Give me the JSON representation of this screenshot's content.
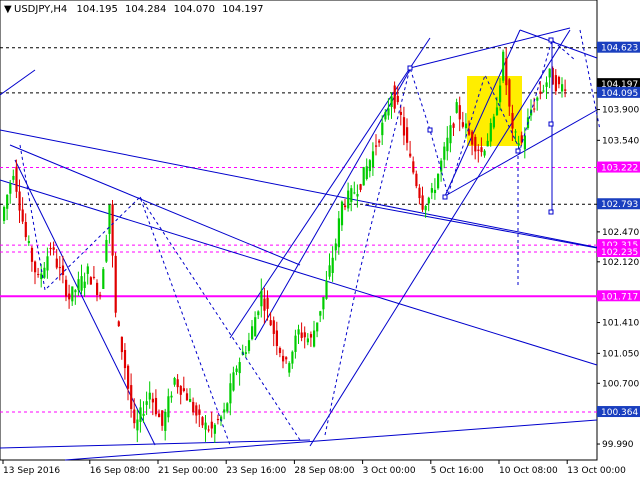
{
  "chart_data": {
    "type": "candlestick",
    "header": {
      "arrow_icon": "triangle-down-icon",
      "symbol": "USDJPY,H4",
      "open": "104.195",
      "high": "104.284",
      "low": "104.070",
      "close": "104.197"
    },
    "ylim": [
      99.85,
      104.9
    ],
    "y_ticks": [
      {
        "value": 103.9,
        "label": "103.900"
      },
      {
        "value": 103.54,
        "label": "103.540"
      },
      {
        "value": 102.47,
        "label": "102.470"
      },
      {
        "value": 102.12,
        "label": "102.120"
      },
      {
        "value": 101.41,
        "label": "101.410"
      },
      {
        "value": 101.05,
        "label": "101.050"
      },
      {
        "value": 100.7,
        "label": "100.700"
      },
      {
        "value": 99.99,
        "label": "99.990"
      }
    ],
    "x_ticks": [
      {
        "bar": 0,
        "label": "13 Sep 2016"
      },
      {
        "bar": 28,
        "label": "16 Sep 08:00"
      },
      {
        "bar": 50,
        "label": "21 Sep 00:00"
      },
      {
        "bar": 72,
        "label": "23 Sep 16:00"
      },
      {
        "bar": 94,
        "label": "28 Sep 08:00"
      },
      {
        "bar": 116,
        "label": "3 Oct 00:00"
      },
      {
        "bar": 138,
        "label": "5 Oct 16:00"
      },
      {
        "bar": 160,
        "label": "10 Oct 08:00"
      },
      {
        "bar": 182,
        "label": "13 Oct 00:00"
      }
    ],
    "levels": [
      {
        "value": 104.623,
        "label": "104.623",
        "color": "#000000",
        "style": "dashed",
        "bg": "#1a3fbf"
      },
      {
        "value": 104.197,
        "label": "104.197",
        "color": "#000000",
        "style": "none",
        "bg": "#000000"
      },
      {
        "value": 104.095,
        "label": "104.095",
        "color": "#000000",
        "style": "dashed",
        "bg": "#1a3fbf"
      },
      {
        "value": 103.222,
        "label": "103.222",
        "color": "#ff00ff",
        "style": "dashed",
        "bg": "#ff00ff"
      },
      {
        "value": 102.793,
        "label": "102.793",
        "color": "#000000",
        "style": "dashed",
        "bg": "#1a3fbf"
      },
      {
        "value": 102.315,
        "label": "102.315",
        "color": "#ff00ff",
        "style": "dashed",
        "bg": "#ff00ff"
      },
      {
        "value": 102.235,
        "label": "102.235",
        "color": "#ff00ff",
        "style": "dashed",
        "bg": "#ff00ff"
      },
      {
        "value": 101.717,
        "label": "101.717",
        "color": "#ff00ff",
        "style": "solid",
        "bg": "#ff00ff"
      },
      {
        "value": 100.364,
        "label": "100.364",
        "color": "#ff00ff",
        "style": "dashed",
        "bg": "#1a3fbf"
      }
    ],
    "colors": {
      "up": "#00cc00",
      "down": "#e00000",
      "lines": "#0000cc",
      "highlight": "#ffee00"
    },
    "price_path": [
      [
        0,
        102.6
      ],
      [
        4,
        103.2
      ],
      [
        8,
        102.4
      ],
      [
        12,
        101.9
      ],
      [
        16,
        102.3
      ],
      [
        22,
        101.7
      ],
      [
        28,
        102.0
      ],
      [
        32,
        101.75
      ],
      [
        35,
        102.8
      ],
      [
        37,
        101.5
      ],
      [
        40,
        100.9
      ],
      [
        43,
        100.15
      ],
      [
        48,
        100.6
      ],
      [
        52,
        100.2
      ],
      [
        56,
        100.75
      ],
      [
        60,
        100.55
      ],
      [
        64,
        100.25
      ],
      [
        68,
        100.15
      ],
      [
        72,
        100.35
      ],
      [
        76,
        100.9
      ],
      [
        80,
        101.2
      ],
      [
        84,
        101.75
      ],
      [
        88,
        101.3
      ],
      [
        92,
        100.9
      ],
      [
        96,
        101.3
      ],
      [
        100,
        101.2
      ],
      [
        104,
        101.7
      ],
      [
        108,
        102.35
      ],
      [
        110,
        102.8
      ],
      [
        113,
        102.9
      ],
      [
        116,
        103.05
      ],
      [
        120,
        103.4
      ],
      [
        124,
        103.8
      ],
      [
        126,
        104.1
      ],
      [
        129,
        103.8
      ],
      [
        132,
        103.3
      ],
      [
        136,
        102.8
      ],
      [
        139,
        102.9
      ],
      [
        143,
        103.4
      ],
      [
        147,
        103.9
      ],
      [
        151,
        103.6
      ],
      [
        155,
        103.4
      ],
      [
        159,
        103.75
      ],
      [
        162,
        104.5
      ],
      [
        165,
        103.6
      ],
      [
        168,
        103.5
      ],
      [
        171,
        103.9
      ],
      [
        174,
        104.1
      ],
      [
        177,
        104.3
      ],
      [
        180,
        104.15
      ],
      [
        182,
        104.2
      ]
    ]
  }
}
